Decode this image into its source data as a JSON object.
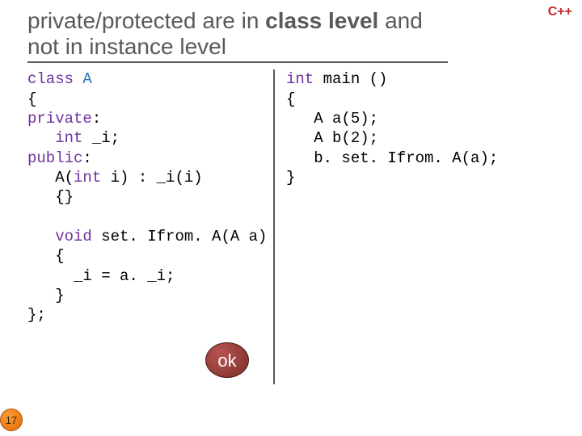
{
  "langTag": "C++",
  "title": {
    "pre": "private/protected are in ",
    "bold": "class level",
    "post": " and not in instance level"
  },
  "code": {
    "left": {
      "l1_kw": "class",
      "l1_name": " A",
      "l2": "{",
      "l3_kw": "private",
      "l3_rest": ":",
      "l4_pre": "   ",
      "l4_kw": "int",
      "l4_rest": " _i;",
      "l5_kw": "public",
      "l5_rest": ":",
      "l6_pre": "   A(",
      "l6_kw": "int",
      "l6_rest": " i) : _i(i)",
      "l7": "   {}",
      "blank1": "",
      "l8_pre": "   ",
      "l8_kw": "void",
      "l8_rest": " set. Ifrom. A(A a)",
      "l9": "   {",
      "l10": "     _i = a. _i;",
      "l11": "   }",
      "l12": "};"
    },
    "right": {
      "l1_kw": "int",
      "l1_rest": " main ()",
      "l2": "{",
      "l3": "   A a(5);",
      "l4": "   A b(2);",
      "l5": "   b. set. Ifrom. A(a);",
      "l6": "}"
    }
  },
  "okLabel": "ok",
  "pageNum": "17"
}
